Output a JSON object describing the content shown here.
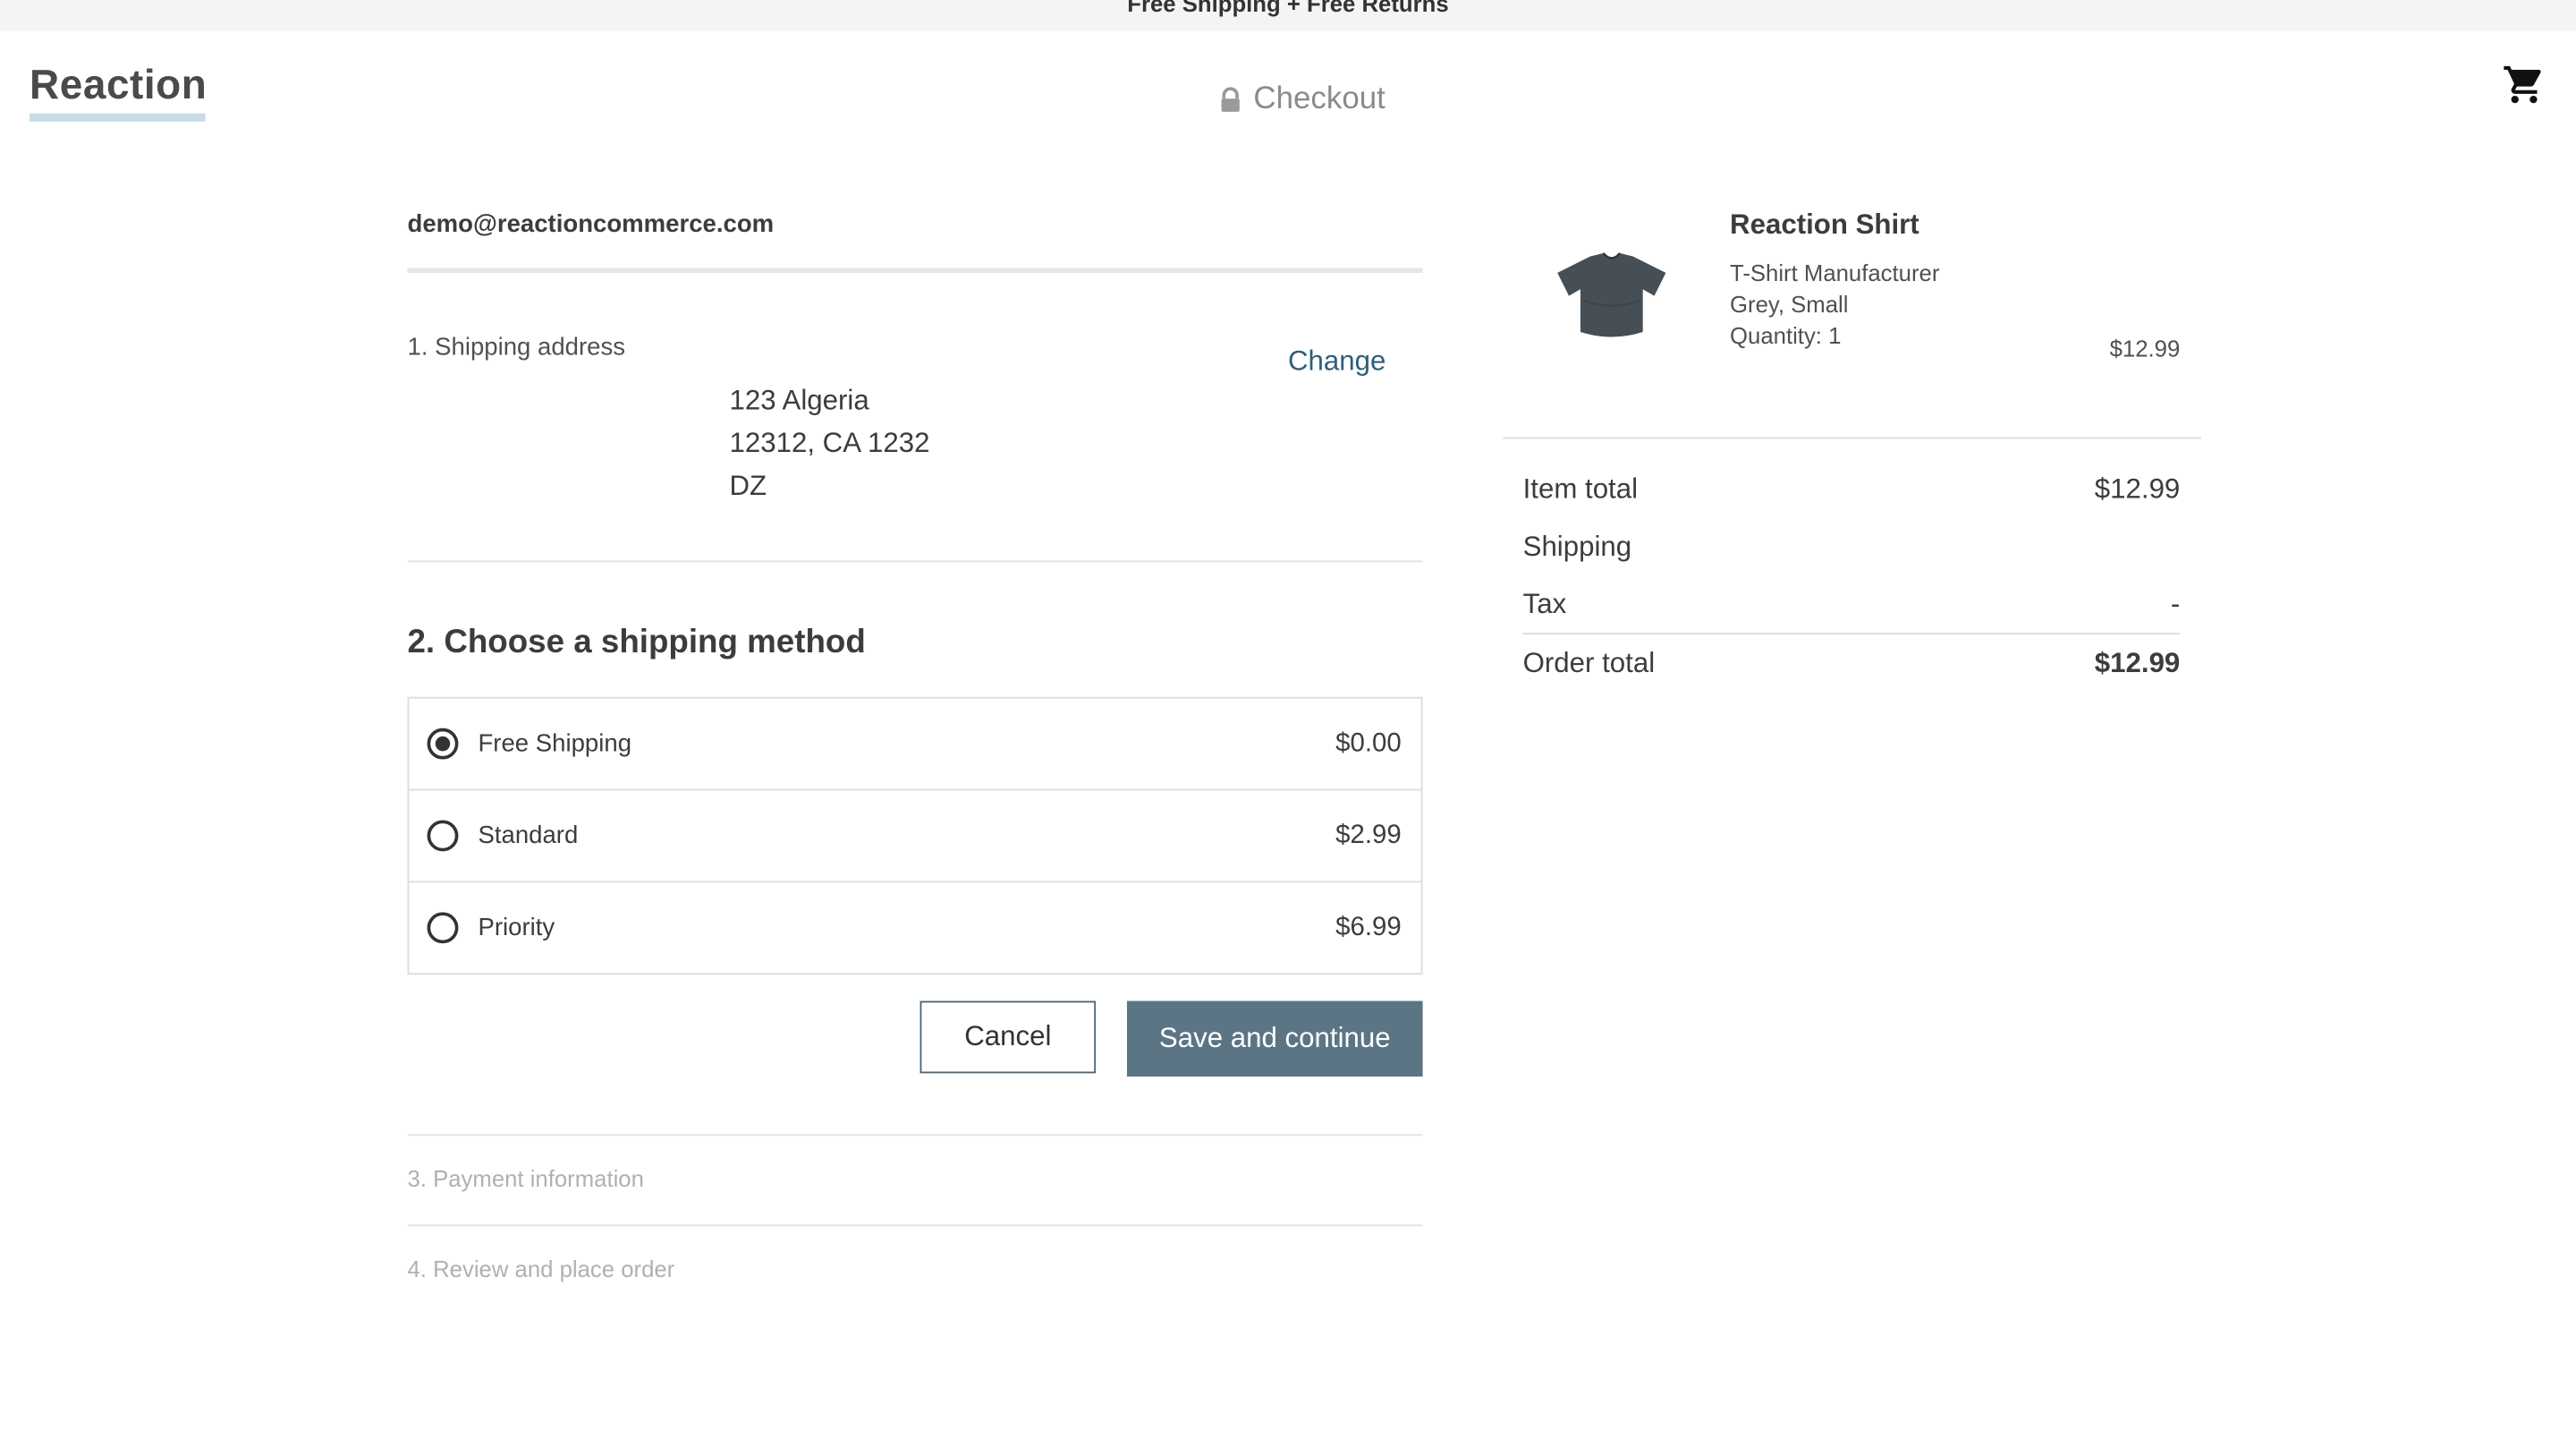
{
  "banner": {
    "text": "Free Shipping + Free Returns"
  },
  "header": {
    "logo": "Reaction",
    "title": "Checkout"
  },
  "account": {
    "email": "demo@reactioncommerce.com"
  },
  "shipping_address": {
    "label": "1. Shipping address",
    "change_label": "Change",
    "line1": "123 Algeria",
    "line2": "12312, CA 1232",
    "line3": "DZ"
  },
  "shipping_method": {
    "heading": "2. Choose a shipping method",
    "options": [
      {
        "name": "Free Shipping",
        "price": "$0.00",
        "selected": true
      },
      {
        "name": "Standard",
        "price": "$2.99",
        "selected": false
      },
      {
        "name": "Priority",
        "price": "$6.99",
        "selected": false
      }
    ],
    "cancel_label": "Cancel",
    "save_label": "Save and continue"
  },
  "steps": {
    "payment": "3. Payment information",
    "review": "4. Review and place order"
  },
  "cart_item": {
    "name": "Reaction Shirt",
    "vendor": "T-Shirt Manufacturer",
    "variant": "Grey, Small",
    "quantity": "Quantity: 1",
    "price": "$12.99"
  },
  "summary": {
    "item_total_label": "Item total",
    "item_total_value": "$12.99",
    "shipping_label": "Shipping",
    "shipping_value": "",
    "tax_label": "Tax",
    "tax_value": "-",
    "order_total_label": "Order total",
    "order_total_value": "$12.99"
  },
  "colors": {
    "primary_button": "#5b7585",
    "link": "#2f5f7a",
    "logo_underline": "#c8dce7"
  },
  "icons": {
    "lock": "lock-icon",
    "cart": "shopping-cart-icon",
    "product": "tshirt-image"
  }
}
